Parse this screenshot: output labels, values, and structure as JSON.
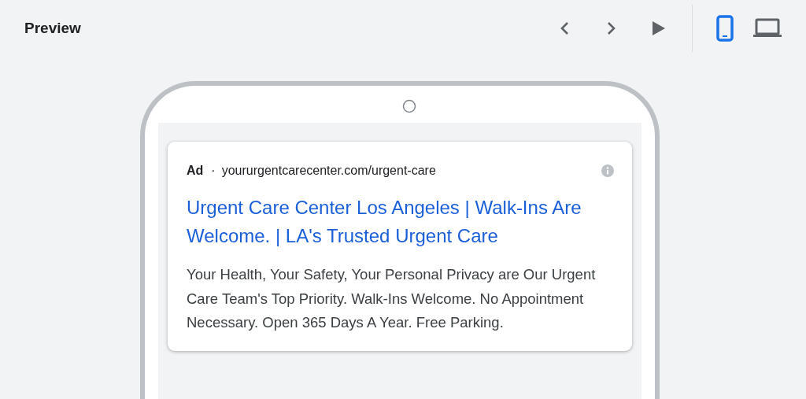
{
  "header": {
    "title": "Preview"
  },
  "controls": [
    {
      "kind": "previous"
    },
    {
      "kind": "next"
    },
    {
      "kind": "play"
    }
  ],
  "devices": [
    {
      "kind": "mobile",
      "selected": true
    },
    {
      "kind": "desktop",
      "selected": false
    }
  ],
  "ad": {
    "label": "Ad",
    "separator": "·",
    "url": "yoururgentcarecenter.com/urgent-care",
    "headline": "Urgent Care Center Los Angeles | Walk-Ins Are Welcome. | LA's Trusted Urgent Care",
    "description": "Your Health, Your Safety, Your Personal Privacy are Our Urgent Care Team's Top Priority. Walk-Ins Welcome. No Appointment Necessary. Open 365 Days A Year. Free Parking."
  }
}
